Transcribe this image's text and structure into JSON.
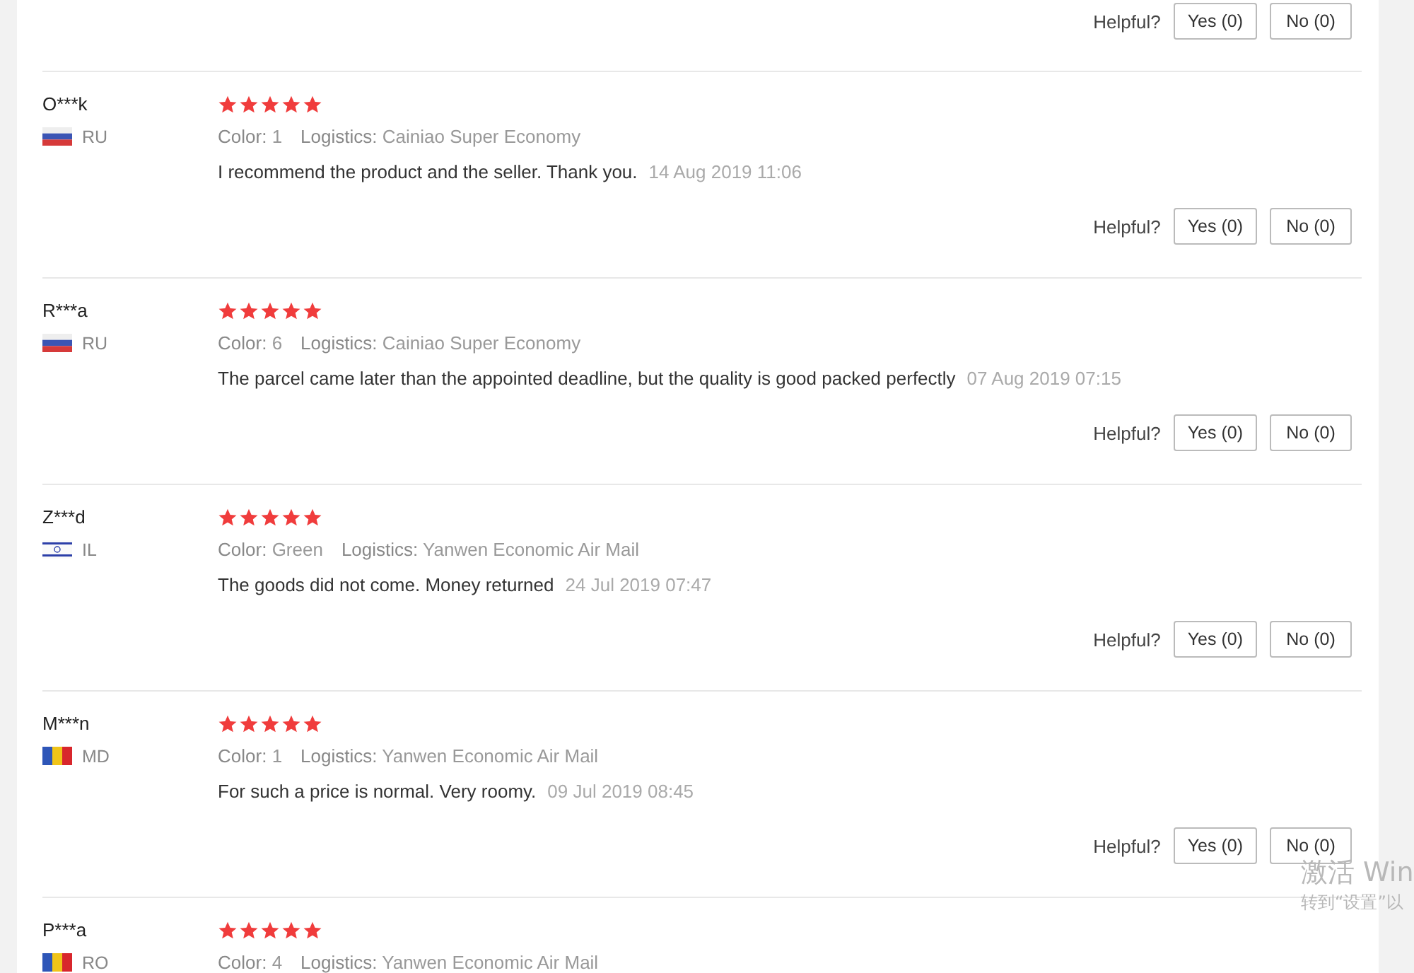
{
  "top_helpful": {
    "label": "Helpful?",
    "yes": "Yes (0)",
    "no": "No (0)"
  },
  "reviews": [
    {
      "user": "O***k",
      "country": "RU",
      "kind": "ru",
      "stars": 5,
      "color_label": "Color:",
      "variant": "1",
      "logistics_label": "Logistics:",
      "logistics": "Cainiao Super Economy",
      "text": "I recommend the product and the seller. Thank you.",
      "date": "14 Aug 2019 11:06",
      "helpful": "Helpful?",
      "yes": "Yes (0)",
      "no": "No (0)"
    },
    {
      "user": "R***a",
      "country": "RU",
      "kind": "ru",
      "stars": 5,
      "color_label": "Color:",
      "variant": "6",
      "logistics_label": "Logistics:",
      "logistics": "Cainiao Super Economy",
      "text": "The parcel came later than the appointed deadline, but the quality is good packed perfectly",
      "date": "07 Aug 2019 07:15",
      "helpful": "Helpful?",
      "yes": "Yes (0)",
      "no": "No (0)"
    },
    {
      "user": "Z***d",
      "country": "IL",
      "kind": "il",
      "stars": 5,
      "color_label": "Color:",
      "variant": "Green",
      "logistics_label": "Logistics:",
      "logistics": "Yanwen Economic Air Mail",
      "text": "The goods did not come. Money returned",
      "date": "24 Jul 2019 07:47",
      "helpful": "Helpful?",
      "yes": "Yes (0)",
      "no": "No (0)"
    },
    {
      "user": "M***n",
      "country": "MD",
      "kind": "md",
      "stars": 5,
      "color_label": "Color:",
      "variant": "1",
      "logistics_label": "Logistics:",
      "logistics": "Yanwen Economic Air Mail",
      "text": "For such a price is normal. Very roomy.",
      "date": "09 Jul 2019 08:45",
      "helpful": "Helpful?",
      "yes": "Yes (0)",
      "no": "No (0)"
    },
    {
      "user": "P***a",
      "country": "RO",
      "kind": "ro",
      "stars": 5,
      "color_label": "Color:",
      "variant": "4",
      "logistics_label": "Logistics:",
      "logistics": "Yanwen Economic Air Mail"
    }
  ],
  "os_notice": {
    "title": "激活 Win",
    "subtitle": "转到“设置”以"
  }
}
